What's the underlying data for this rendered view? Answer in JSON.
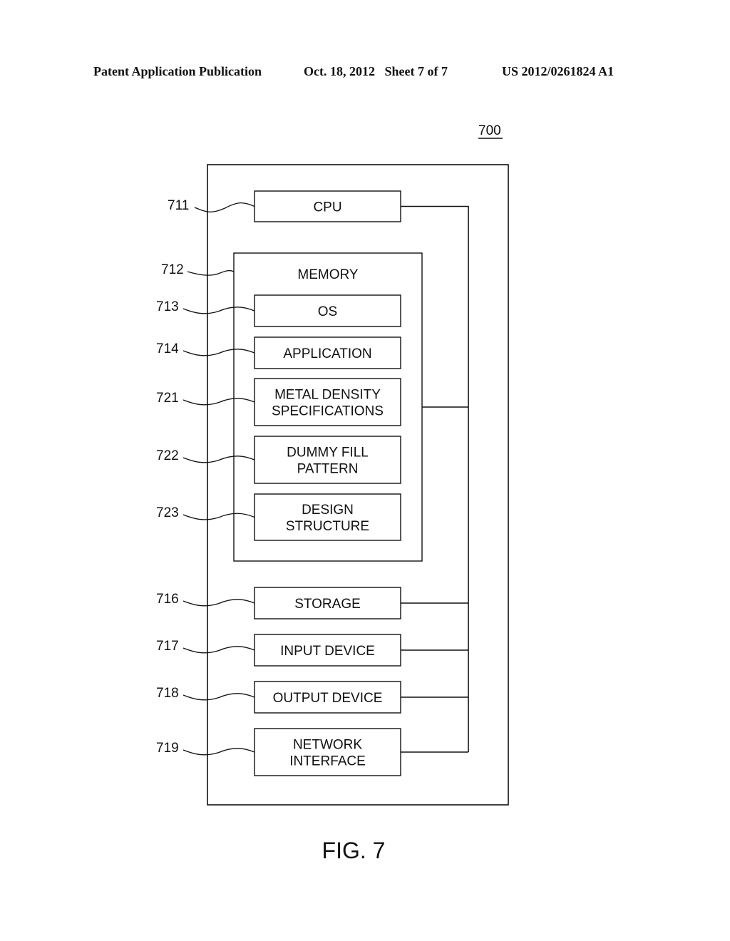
{
  "header": {
    "publication": "Patent Application Publication",
    "date_sheet": "Oct. 18, 2012   Sheet 7 of 7",
    "patent_number": "US 2012/0261824 A1"
  },
  "figure": {
    "ref": "700",
    "caption": "FIG. 7"
  },
  "memory": {
    "ref": "712",
    "label": "MEMORY"
  },
  "blocks": [
    {
      "id": "cpu",
      "ref": "711",
      "lines": [
        "CPU"
      ]
    },
    {
      "id": "os",
      "ref": "713",
      "lines": [
        "OS"
      ]
    },
    {
      "id": "application",
      "ref": "714",
      "lines": [
        "APPLICATION"
      ]
    },
    {
      "id": "metal-density",
      "ref": "721",
      "lines": [
        "METAL DENSITY",
        "SPECIFICATIONS"
      ]
    },
    {
      "id": "dummy-fill",
      "ref": "722",
      "lines": [
        "DUMMY FILL",
        "PATTERN"
      ]
    },
    {
      "id": "design-structure",
      "ref": "723",
      "lines": [
        "DESIGN",
        "STRUCTURE"
      ]
    },
    {
      "id": "storage",
      "ref": "716",
      "lines": [
        "STORAGE"
      ]
    },
    {
      "id": "input-device",
      "ref": "717",
      "lines": [
        "INPUT DEVICE"
      ]
    },
    {
      "id": "output-device",
      "ref": "718",
      "lines": [
        "OUTPUT DEVICE"
      ]
    },
    {
      "id": "network-interface",
      "ref": "719",
      "lines": [
        "NETWORK",
        "INTERFACE"
      ]
    }
  ]
}
